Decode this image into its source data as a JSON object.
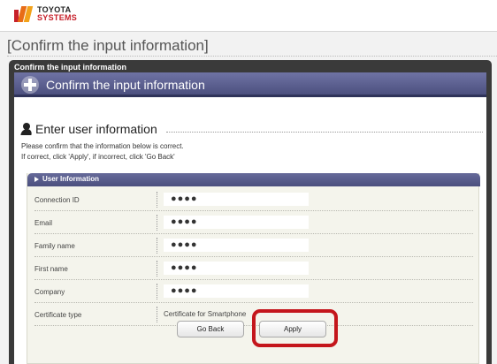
{
  "header": {
    "logo_line1": "TOYOTA",
    "logo_line2": "SYSTEMS"
  },
  "page": {
    "title": "[Confirm the input information]"
  },
  "panel": {
    "caption": "Confirm the input information",
    "section_title": "Confirm the input information",
    "subhead": "Enter user information",
    "instructions_line1": "Please confirm that the information below is correct.",
    "instructions_line2": "If correct, click 'Apply', if incorrect, click 'Go Back'"
  },
  "user_info": {
    "header": "User Information",
    "rows": [
      {
        "label": "Connection ID",
        "value": "●●●●"
      },
      {
        "label": "Email",
        "value": "●●●●"
      },
      {
        "label": "Family name",
        "value": "●●●●"
      },
      {
        "label": "First name",
        "value": "●●●●"
      },
      {
        "label": "Company",
        "value": "●●●●"
      },
      {
        "label": "Certificate type",
        "value": "Certificate for Smartphone"
      }
    ]
  },
  "buttons": {
    "go_back": "Go Back",
    "apply": "Apply"
  },
  "colors": {
    "section_bar": "#5a5e8e",
    "panel_frame": "#3a3a3a",
    "highlight": "#c4161c",
    "logo_red": "#c7202a"
  }
}
